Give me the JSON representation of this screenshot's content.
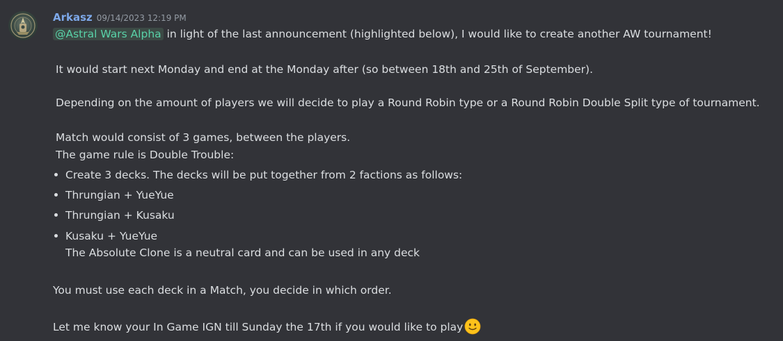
{
  "message": {
    "author": "Arkasz",
    "timestamp": "09/14/2023 12:19 PM",
    "mention": "@Astral Wars Alpha",
    "line1_rest": " in light of the last announcement (highlighted below), I would like to create another AW tournament!",
    "line2": "It would start next Monday and end at the Monday after (so between 18th and 25th of September).",
    "line3": "Depending on the amount of players we will decide to play a Round Robin type or a Round Robin Double Split type of tournament.",
    "line4": "Match would consist of 3 games, between the players.",
    "line5": "The game rule is Double Trouble:",
    "bullets": [
      "Create 3 decks. The decks will be put together from 2 factions as follows:",
      "Thrungian + YueYue",
      "Thrungian + Kusaku",
      "Kusaku + YueYue"
    ],
    "bullet_continuation": "The Absolute Clone is a neutral card and can be used in any deck",
    "line6": "You must use each deck in a Match, you decide in which order.",
    "line7": "Let me know your In Game IGN till Sunday the 17th if you would like to play",
    "emoji": "slightly-smiling-face"
  },
  "colors": {
    "background": "#323338",
    "username": "#7da8e8",
    "mention_text": "#59d2a8",
    "mention_bg": "#3c4a45",
    "text": "#dbdee1",
    "timestamp": "#949ba4"
  }
}
